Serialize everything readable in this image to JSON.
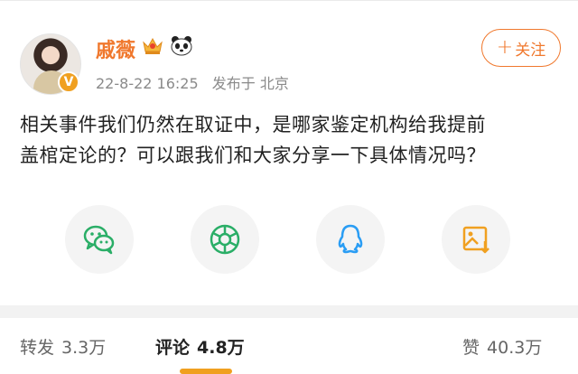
{
  "post": {
    "author": "戚薇",
    "verified_badge": "V",
    "timestamp": "22-8-22 16:25",
    "location": "发布于 北京",
    "follow_label": "+关注",
    "follow_plus": "+",
    "follow_text": "关注",
    "content_line1": "相关事件我们仍然在取证中，是哪家鉴定机构给我提前",
    "content_line2": "盖棺定论的？可以跟我们和大家分享一下具体情况吗？"
  },
  "share_targets": [
    {
      "icon": "wechat-icon",
      "color": "#2aae67"
    },
    {
      "icon": "moments-icon",
      "color": "#2aae67"
    },
    {
      "icon": "qq-icon",
      "color": "#2a9df4"
    },
    {
      "icon": "save-image-icon",
      "color": "#f0a020"
    }
  ],
  "stats": {
    "repost_label": "转发",
    "repost_count": "3.3万",
    "comment_label": "评论",
    "comment_count": "4.8万",
    "like_label": "赞",
    "like_count": "40.3万"
  },
  "colors": {
    "accent": "#f0782d",
    "tab_indicator": "#f0a020"
  }
}
